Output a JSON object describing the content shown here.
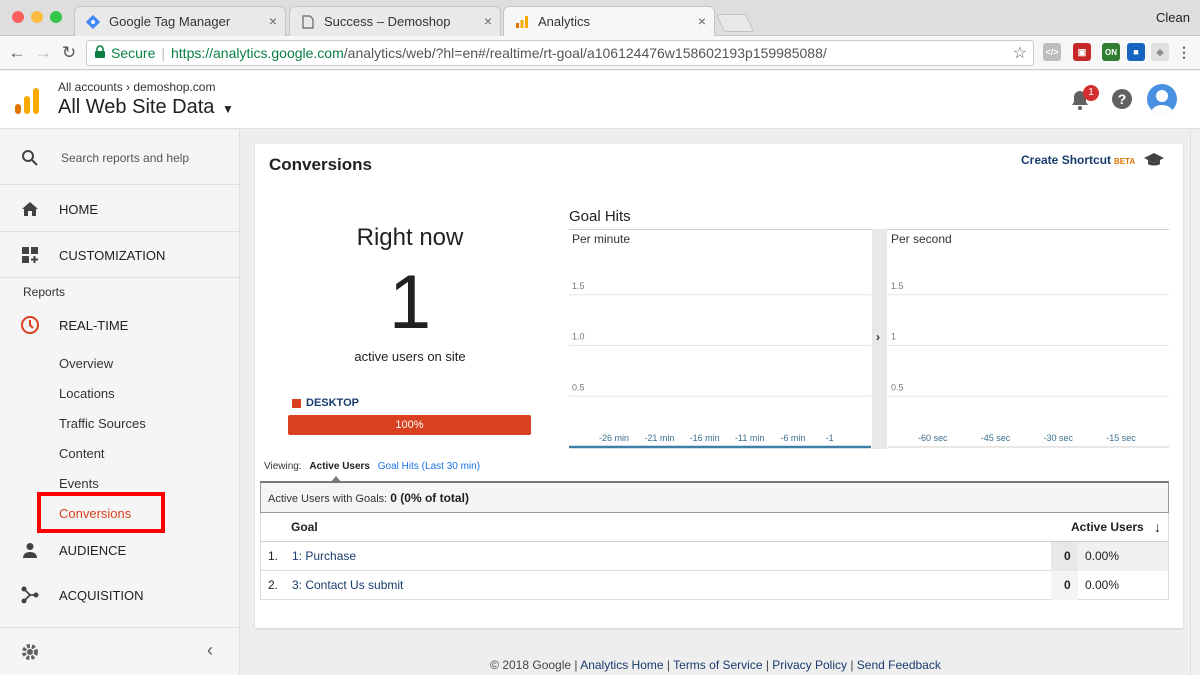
{
  "browser": {
    "tabs": [
      {
        "title": "Google Tag Manager"
      },
      {
        "title": "Success – Demoshop"
      },
      {
        "title": "Analytics"
      }
    ],
    "profile_label": "Clean",
    "secure_label": "Secure",
    "url_host": "https://analytics.google.com",
    "url_path": "/analytics/web/?hl=en#/realtime/rt-goal/a106124476w158602193p159985088/",
    "extensions": [
      {
        "icon": "code-icon",
        "color": "#9e9e9e"
      },
      {
        "icon": "tag-icon",
        "color": "#c62828"
      },
      {
        "icon": "on-badge-icon",
        "color": "#2e7d32",
        "text": "ON"
      },
      {
        "icon": "pin-icon",
        "color": "#1565c0"
      },
      {
        "icon": "shield-icon",
        "color": "#bdbdbd"
      },
      {
        "icon": "menu-icon",
        "color": "#757575"
      }
    ]
  },
  "header": {
    "breadcrumb_all": "All accounts",
    "breadcrumb_sep": "›",
    "breadcrumb_account": "demoshop.com",
    "property": "All Web Site Data",
    "notification_count": "1"
  },
  "sidebar": {
    "search_placeholder": "Search reports and help",
    "home": "HOME",
    "customization": "CUSTOMIZATION",
    "reports_heading": "Reports",
    "realtime": "REAL-TIME",
    "realtime_items": [
      "Overview",
      "Locations",
      "Traffic Sources",
      "Content",
      "Events",
      "Conversions"
    ],
    "audience": "AUDIENCE",
    "acquisition": "ACQUISITION"
  },
  "main": {
    "title": "Conversions",
    "create_shortcut": "Create Shortcut",
    "beta": "BETA",
    "right_now": "Right now",
    "active_count": "1",
    "active_label": "active users on site",
    "device_label": "DESKTOP",
    "device_share": 1.0,
    "device_share_label": "100%",
    "goal_hits_title": "Goal Hits",
    "viewing_label": "Viewing:",
    "viewing_active": "Active Users",
    "viewing_other": "Goal Hits (Last 30 min)",
    "summary_label": "Active Users with Goals:",
    "summary_value": "0 (0% of total)",
    "table": {
      "col_goal": "Goal",
      "col_users": "Active Users",
      "rows": [
        {
          "idx": "1.",
          "goal": "1: Purchase",
          "users": "0",
          "pct": "0.00%"
        },
        {
          "idx": "2.",
          "goal": "3: Contact Us submit",
          "users": "0",
          "pct": "0.00%"
        }
      ]
    }
  },
  "chart_data": [
    {
      "type": "bar",
      "title": "Per minute",
      "ylim": [
        0,
        2
      ],
      "yticks": [
        "1.5",
        "1.0",
        "0.5"
      ],
      "xticks": [
        "-26 min",
        "-21 min",
        "-16 min",
        "-11 min",
        "-6 min",
        "-1"
      ],
      "values": []
    },
    {
      "type": "bar",
      "title": "Per second",
      "ylim": [
        0,
        2
      ],
      "yticks": [
        "1.5",
        "1",
        "0.5"
      ],
      "xticks": [
        "-60 sec",
        "-45 sec",
        "-30 sec",
        "-15 sec"
      ],
      "values": []
    }
  ],
  "footer": {
    "copyright": "© 2018 Google",
    "links": [
      "Analytics Home",
      "Terms of Service",
      "Privacy Policy",
      "Send Feedback"
    ]
  },
  "colors": {
    "accent": "#d8401f",
    "highlight_box": "#ff0000",
    "link": "#1a3b6e"
  }
}
